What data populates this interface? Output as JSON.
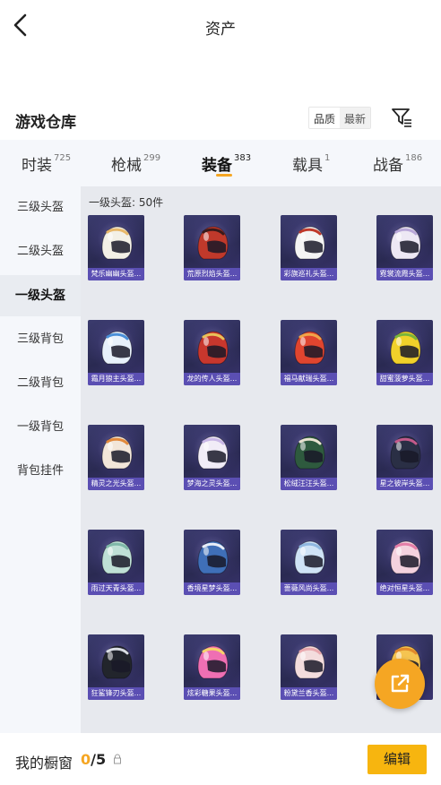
{
  "header": {
    "title": "资产"
  },
  "section": {
    "title": "游戏仓库",
    "sort_options": [
      "品质",
      "最新"
    ]
  },
  "tabs": [
    {
      "label": "时装",
      "count": "725"
    },
    {
      "label": "枪械",
      "count": "299"
    },
    {
      "label": "装备",
      "count": "383",
      "active": true
    },
    {
      "label": "载具",
      "count": "1"
    },
    {
      "label": "战备",
      "count": "186"
    }
  ],
  "sidebar": [
    {
      "label": "三级头盔"
    },
    {
      "label": "二级头盔"
    },
    {
      "label": "一级头盔",
      "active": true
    },
    {
      "label": "三级背包"
    },
    {
      "label": "二级背包"
    },
    {
      "label": "一级背包"
    },
    {
      "label": "背包挂件"
    }
  ],
  "group": {
    "label": "一级头盔: 50件"
  },
  "items": [
    {
      "name": "梵乐幽幽头盔...",
      "color": "#f3f0e6",
      "accent": "#e8b86a"
    },
    {
      "name": "荒原烈焰头盔...",
      "color": "#c0392b",
      "accent": "#3a1a1a"
    },
    {
      "name": "彩旗巡礼头盔...",
      "color": "#f4f4f4",
      "accent": "#c0392b"
    },
    {
      "name": "霓裳流霞头盔...",
      "color": "#ede8f4",
      "accent": "#b9a8d8"
    },
    {
      "name": "霜月狼主头盔...",
      "color": "#e8f1fb",
      "accent": "#4a8fd8"
    },
    {
      "name": "龙的传人头盔...",
      "color": "#c8372d",
      "accent": "#e8c25a"
    },
    {
      "name": "福马献瑞头盔...",
      "color": "#e0452f",
      "accent": "#f0a64a"
    },
    {
      "name": "甜蜜菠萝头盔...",
      "color": "#f1d12a",
      "accent": "#7ab43a"
    },
    {
      "name": "精灵之光头盔...",
      "color": "#f2e6d9",
      "accent": "#e2893b"
    },
    {
      "name": "梦海之灵头盔...",
      "color": "#f1ecf7",
      "accent": "#c9b7e6"
    },
    {
      "name": "松绒汪汪头盔...",
      "color": "#2e5a3e",
      "accent": "#e8e2d0"
    },
    {
      "name": "星之彼岸头盔...",
      "color": "#2a2f45",
      "accent": "#c35a8a"
    },
    {
      "name": "雨过天青头盔...",
      "color": "#bfe0d6",
      "accent": "#7fb8a8"
    },
    {
      "name": "香境星梦头盔...",
      "color": "#3f6fb8",
      "accent": "#e8edf7"
    },
    {
      "name": "蔷薇风尚头盔...",
      "color": "#cfe3f6",
      "accent": "#8fb7e0"
    },
    {
      "name": "绝对恒星头盔...",
      "color": "#f4d2de",
      "accent": "#e47ea8"
    },
    {
      "name": "狂鲨锋刃头盔...",
      "color": "#22252c",
      "accent": "#d9dde3"
    },
    {
      "name": "炫彩糖果头盔...",
      "color": "#ef6fb3",
      "accent": "#f7d36a"
    },
    {
      "name": "粉黛兰香头盔...",
      "color": "#f3dcdd",
      "accent": "#e8a7ad"
    },
    {
      "name": "",
      "color": "#f5c451",
      "accent": "#e2892b"
    }
  ],
  "footer": {
    "label": "我的橱窗",
    "current": "0",
    "total": "/5",
    "edit_label": "编辑"
  },
  "colors": {
    "accent": "#f5a623",
    "card_name_bg": "#5b4fb3",
    "edit_bg": "#f7b50f"
  }
}
